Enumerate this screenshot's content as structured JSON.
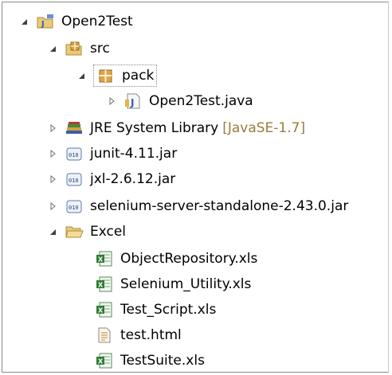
{
  "tree": {
    "project": {
      "label": "Open2Test",
      "icon": "java-project-icon",
      "expanded": true
    },
    "src": {
      "label": "src",
      "icon": "source-folder-icon",
      "expanded": true
    },
    "pack": {
      "label": "pack",
      "icon": "package-icon",
      "expanded": true,
      "selected": true
    },
    "java_file": {
      "label": "Open2Test.java",
      "icon": "java-file-icon",
      "expanded": false
    },
    "jre": {
      "label": "JRE System Library",
      "decoration": "[JavaSE-1.7]",
      "icon": "library-icon",
      "expanded": false
    },
    "jars": [
      {
        "label": "junit-4.11.jar",
        "icon": "jar-icon"
      },
      {
        "label": "jxl-2.6.12.jar",
        "icon": "jar-icon"
      },
      {
        "label": "selenium-server-standalone-2.43.0.jar",
        "icon": "jar-icon"
      }
    ],
    "excel_folder": {
      "label": "Excel",
      "icon": "folder-icon",
      "expanded": true
    },
    "excel_files": [
      {
        "label": "ObjectRepository.xls",
        "icon": "excel-file-icon"
      },
      {
        "label": "Selenium_Utility.xls",
        "icon": "excel-file-icon"
      },
      {
        "label": "Test_Script.xls",
        "icon": "excel-file-icon"
      },
      {
        "label": "test.html",
        "icon": "html-file-icon"
      },
      {
        "label": "TestSuite.xls",
        "icon": "excel-file-icon"
      }
    ]
  },
  "colors": {
    "decoration": "#9b7b3b",
    "border": "#8a8a8a"
  }
}
